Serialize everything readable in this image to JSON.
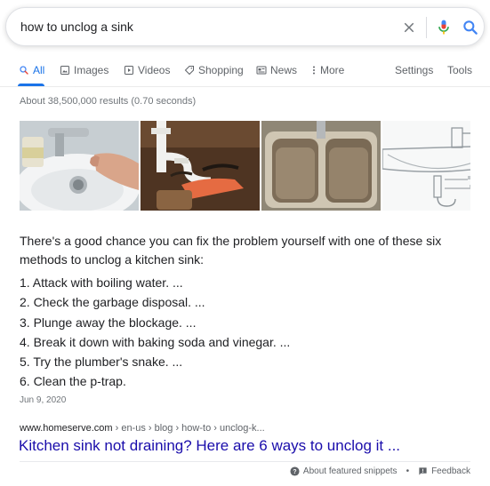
{
  "search": {
    "query": "how to unclog a sink"
  },
  "tabs": [
    {
      "label": "All",
      "icon": "search-icon"
    },
    {
      "label": "Images",
      "icon": "image-icon"
    },
    {
      "label": "Videos",
      "icon": "video-icon"
    },
    {
      "label": "Shopping",
      "icon": "tag-icon"
    },
    {
      "label": "News",
      "icon": "newspaper-icon"
    },
    {
      "label": "More",
      "icon": "more-vert-icon"
    }
  ],
  "tools": {
    "settings": "Settings",
    "tools": "Tools"
  },
  "stats": "About 38,500,000 results (0.70 seconds)",
  "snippet": {
    "intro": "There's a good chance you can fix the problem yourself with one of these six methods to unclog a kitchen sink:",
    "steps": [
      "1. Attack with boiling water. ...",
      "2. Check the garbage disposal. ...",
      "3. Plunge away the blockage. ...",
      "4. Break it down with baking soda and vinegar. ...",
      "5. Try the plumber's snake. ...",
      "6. Clean the p-trap."
    ],
    "date": "Jun 9, 2020"
  },
  "result": {
    "domain": "www.homeserve.com",
    "path": " › en-us › blog › how-to › unclog-k...",
    "title": "Kitchen sink not draining? Here are 6 ways to unclog it ..."
  },
  "footer": {
    "about": "About featured snippets",
    "separator": "•",
    "feedback": "Feedback"
  },
  "colors": {
    "link": "#1a0dab",
    "accent": "#1a73e8",
    "secondary": "#5f6368"
  }
}
